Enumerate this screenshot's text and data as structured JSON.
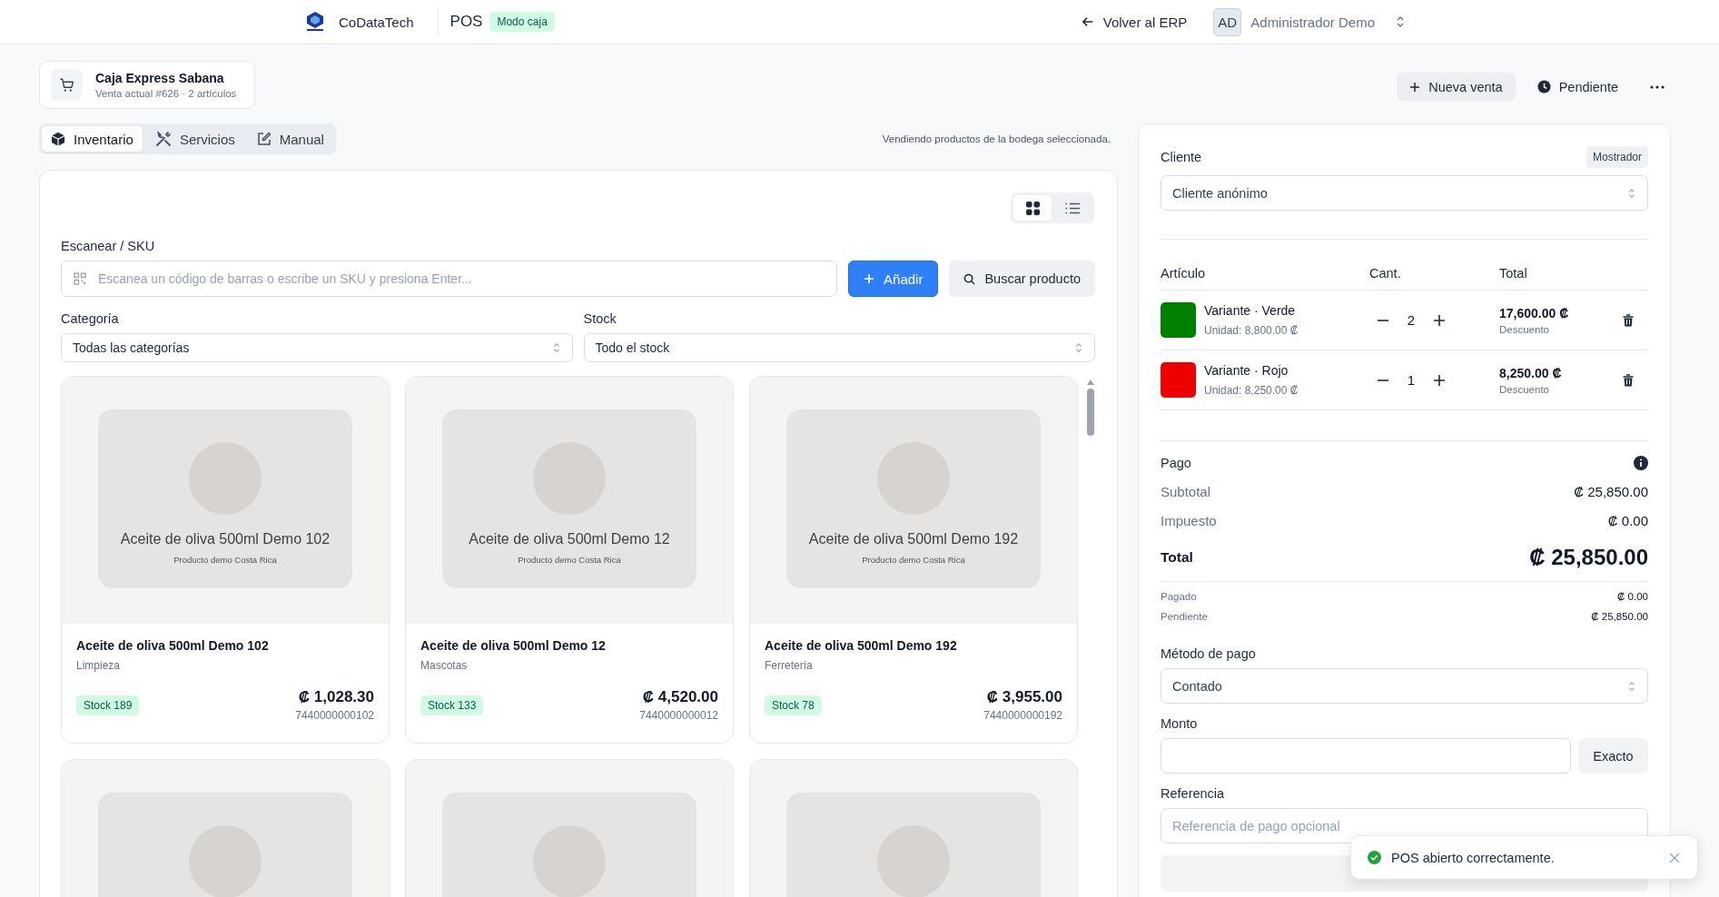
{
  "topbar": {
    "brand": "CoDataTech",
    "app": "POS",
    "mode_badge": "Modo caja",
    "back_link": "Volver al ERP",
    "user": {
      "initials": "AD",
      "name": "Administrador Demo"
    }
  },
  "register": {
    "name": "Caja Express Sabana",
    "subtitle": "Venta actual #626 · 2 artículos"
  },
  "header_actions": [
    {
      "label": "Nueva venta",
      "kind": "new"
    },
    {
      "label": "Pendiente",
      "kind": "pending"
    }
  ],
  "tabs": [
    {
      "label": "Inventario",
      "kind": "box",
      "selected": true
    },
    {
      "label": "Servicios",
      "kind": "tools",
      "selected": false
    },
    {
      "label": "Manual",
      "kind": "edit",
      "selected": false
    }
  ],
  "notice": "Vendiendo productos de la bodega seleccionada.",
  "view_modes": [
    {
      "kind": "grid",
      "selected": true
    },
    {
      "kind": "list",
      "selected": false
    }
  ],
  "scan": {
    "label": "Escanear / SKU",
    "placeholder": "Escanea un código de barras o escribe un SKU y presiona Enter...",
    "add_button": "Añadir",
    "search_button": "Buscar producto"
  },
  "filters": [
    {
      "label": "Categoría",
      "value": "Todas las categorías"
    },
    {
      "label": "Stock",
      "value": "Todo el stock"
    }
  ],
  "products": [
    {
      "kind": "full",
      "image_title": "Aceite de oliva 500ml Demo 102",
      "image_caption": "Producto demo Costa Rica",
      "name": "Aceite de oliva 500ml Demo 102",
      "category": "Limpieza",
      "stock": "Stock 189",
      "price": "₡ 1,028.30",
      "barcode": "7440000000102"
    },
    {
      "kind": "full",
      "image_title": "Aceite de oliva 500ml Demo 12",
      "image_caption": "Producto demo Costa Rica",
      "name": "Aceite de oliva 500ml Demo 12",
      "category": "Mascotas",
      "stock": "Stock 133",
      "price": "₡ 4,520.00",
      "barcode": "7440000000012"
    },
    {
      "kind": "full",
      "image_title": "Aceite de oliva 500ml Demo 192",
      "image_caption": "Producto demo Costa Rica",
      "name": "Aceite de oliva 500ml Demo 192",
      "category": "Ferretería",
      "stock": "Stock 78",
      "price": "₡ 3,955.00",
      "barcode": "7440000000192"
    },
    {
      "kind": "cut"
    },
    {
      "kind": "cut"
    },
    {
      "kind": "cut"
    }
  ],
  "cart": {
    "client_label": "Cliente",
    "client_badge": "Mostrador",
    "client_value": "Cliente anónimo",
    "columns": [
      "Artículo",
      "Cant.",
      "Total"
    ],
    "items": [
      {
        "name": "Variante · Verde",
        "color": "#008000",
        "unit": "Unidad: 8,800.00 ₡",
        "qty": "2",
        "total": "17,600.00 ₡",
        "discount": "Descuento"
      },
      {
        "name": "Variante · Rojo",
        "color": "#ee0000",
        "unit": "Unidad: 8,250.00 ₡",
        "qty": "1",
        "total": "8,250.00 ₡",
        "discount": "Descuento"
      }
    ]
  },
  "payment": {
    "title": "Pago",
    "lines": [
      {
        "kind": "main",
        "label": "Subtotal",
        "value": "₡ 25,850.00"
      },
      {
        "kind": "main",
        "label": "Impuesto",
        "value": "₡ 0.00"
      },
      {
        "kind": "total",
        "label": "Total",
        "value": "₡ 25,850.00"
      },
      {
        "kind": "small",
        "label": "Pagado",
        "value": "₡ 0.00"
      },
      {
        "kind": "small",
        "label": "Pendiente",
        "value": "₡ 25,850.00"
      }
    ],
    "method_label": "Método de pago",
    "method_value": "Contado",
    "amount_label": "Monto",
    "exact_button": "Exacto",
    "reference_label": "Referencia",
    "reference_placeholder": "Referencia de pago opcional"
  },
  "toast": {
    "message": "POS abierto correctamente."
  }
}
